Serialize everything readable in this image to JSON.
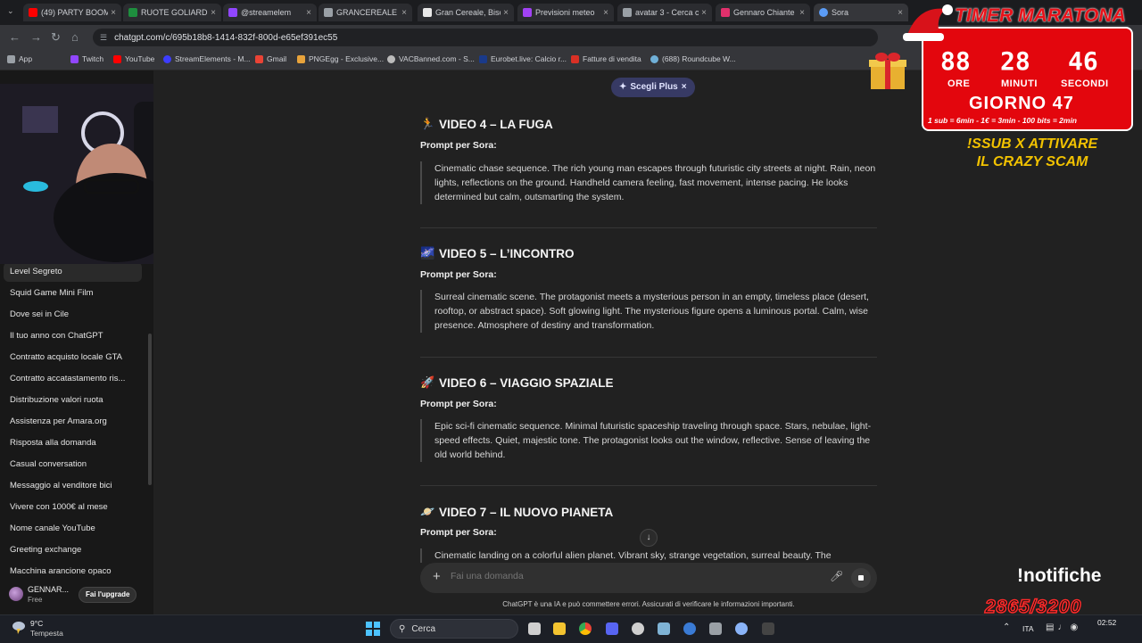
{
  "browser": {
    "tabs": [
      {
        "title": "(49) PARTY BOOM",
        "icon_color": "#ff0000"
      },
      {
        "title": "RUOTE GOLIARDI",
        "icon_color": "#1e8e3e"
      },
      {
        "title": "@streamelem",
        "icon_color": "#9146ff"
      },
      {
        "title": "🔔 @streamelem",
        "icon_color": "#f4b400"
      },
      {
        "title": "GRANCEREALE PI",
        "icon_color": "#9aa0a6"
      },
      {
        "title": "Gran Cereale, Bisc",
        "icon_color": "#e8e8e8"
      },
      {
        "title": "Previsioni meteo",
        "icon_color": "#a142f4"
      },
      {
        "title": "avatar 3 - Cerca c",
        "icon_color": "#9aa0a6"
      },
      {
        "title": "Gennaro Chiante",
        "icon_color": "#e1306c"
      },
      {
        "title": "Sora",
        "icon_color": "#5b9cf6"
      }
    ],
    "url": "chatgpt.com/c/695b18b8-1414-832f-800d-e65ef391ec55",
    "bookmarks": [
      {
        "label": "App",
        "icon_color": "#9aa0a6"
      },
      {
        "label": "Twitch",
        "icon_color": "#9146ff"
      },
      {
        "label": "YouTube",
        "icon_color": "#ff0000"
      },
      {
        "label": "StreamElements - M...",
        "icon_color": "#3d3dff"
      },
      {
        "label": "Gmail",
        "icon_color": "#ea4335"
      },
      {
        "label": "PNGEgg - Exclusive...",
        "icon_color": "#e8a33b"
      },
      {
        "label": "VACBanned.com - S...",
        "icon_color": "#bbbbbb"
      },
      {
        "label": "Eurobet.live: Calcio r...",
        "icon_color": "#1a3a8a"
      },
      {
        "label": "Fatture di vendita",
        "icon_color": "#d93025"
      },
      {
        "label": "(688) Roundcube W...",
        "icon_color": "#70b0d8"
      }
    ]
  },
  "sidebar": {
    "items": [
      "Level Segreto",
      "Squid Game Mini Film",
      "Dove sei in Cile",
      "Il tuo anno con ChatGPT",
      "Contratto acquisto locale GTA",
      "Contratto accatastamento ris...",
      "Distribuzione valori ruota",
      "Assistenza per Amara.org",
      "Risposta alla domanda",
      "Casual conversation",
      "Messaggio al venditore bici",
      "Vivere con 1000€ al mese",
      "Nome canale YouTube",
      "Greeting exchange",
      "Macchina arancione opaco"
    ],
    "user_name": "GENNAR...",
    "user_plan": "Free",
    "upgrade_label": "Fai l'upgrade"
  },
  "main": {
    "plus_badge": "Scegli Plus",
    "sections": [
      {
        "emoji": "🏃",
        "title": "VIDEO 4 – LA FUGA",
        "label": "Prompt per Sora:",
        "prompt": "Cinematic chase sequence. The rich young man escapes through futuristic city streets at night. Rain, neon lights, reflections on the ground. Handheld camera feeling, fast movement, intense pacing. He looks determined but calm, outsmarting the system."
      },
      {
        "emoji": "🌌",
        "title": "VIDEO 5 – L’INCONTRO",
        "label": "Prompt per Sora:",
        "prompt": "Surreal cinematic scene. The protagonist meets a mysterious person in an empty, timeless place (desert, rooftop, or abstract space). Soft glowing light. The mysterious figure opens a luminous portal. Calm, wise presence. Atmosphere of destiny and transformation."
      },
      {
        "emoji": "🚀",
        "title": "VIDEO 6 – VIAGGIO SPAZIALE",
        "label": "Prompt per Sora:",
        "prompt": "Epic sci-fi cinematic sequence. Minimal futuristic spaceship traveling through space. Stars, nebulae, light-speed effects. Quiet, majestic tone. The protagonist looks out the window, reflective. Sense of leaving the old world behind."
      },
      {
        "emoji": "🪐",
        "title": "VIDEO 7 – IL NUOVO PIANETA",
        "label": "Prompt per Sora:",
        "prompt": "Cinematic landing on a colorful alien planet. Vibrant sky, strange vegetation, surreal beauty. The"
      }
    ],
    "composer_placeholder": "Fai una domanda",
    "disclaimer": "ChatGPT è una IA e può commettere errori. Assicurati di verificare le informazioni importanti."
  },
  "overlay": {
    "timer_title": "TIMER MARATONA",
    "hours": "88",
    "minutes": "28",
    "seconds": "46",
    "hours_label": "ORE",
    "minutes_label": "MINUTI",
    "seconds_label": "SECONDI",
    "day": "GIORNO 47",
    "rules": "1 sub = 6min - 1€ = 3min - 100 bits = 2min",
    "sub_promo": "!SSUB X ATTIVARE IL CRAZY SCAM",
    "notifiche": "!notifiche",
    "counter": "2865/3200"
  },
  "taskbar": {
    "temperature": "9°C",
    "weather": "Tempesta",
    "search_label": "Cerca",
    "language": "ITA",
    "time": "02:52",
    "icons": [
      "file-explorer-icon",
      "folder-icon",
      "chrome-icon",
      "discord-icon",
      "obs-icon",
      "notepad-icon",
      "app-icon",
      "mic-icon",
      "settings-icon",
      "app2-icon"
    ]
  },
  "colors": {
    "accent_plus": "#373a64",
    "timer_red": "#e3060d",
    "promo_yellow": "#f2c200"
  }
}
